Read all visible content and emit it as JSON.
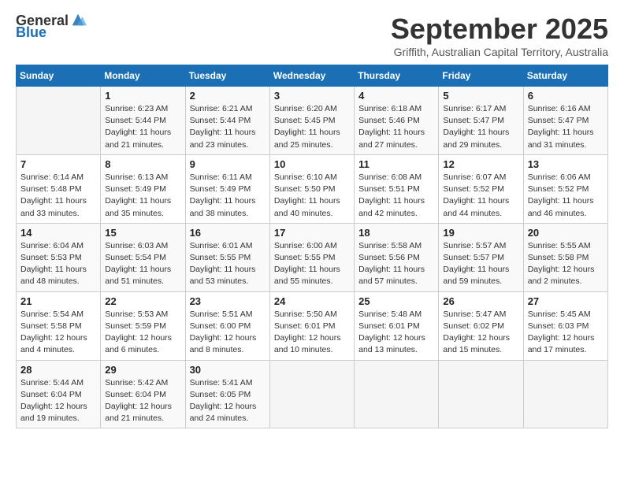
{
  "header": {
    "logo_general": "General",
    "logo_blue": "Blue",
    "title": "September 2025",
    "location": "Griffith, Australian Capital Territory, Australia"
  },
  "calendar": {
    "days_of_week": [
      "Sunday",
      "Monday",
      "Tuesday",
      "Wednesday",
      "Thursday",
      "Friday",
      "Saturday"
    ],
    "weeks": [
      [
        {
          "day": "",
          "info": ""
        },
        {
          "day": "1",
          "info": "Sunrise: 6:23 AM\nSunset: 5:44 PM\nDaylight: 11 hours\nand 21 minutes."
        },
        {
          "day": "2",
          "info": "Sunrise: 6:21 AM\nSunset: 5:44 PM\nDaylight: 11 hours\nand 23 minutes."
        },
        {
          "day": "3",
          "info": "Sunrise: 6:20 AM\nSunset: 5:45 PM\nDaylight: 11 hours\nand 25 minutes."
        },
        {
          "day": "4",
          "info": "Sunrise: 6:18 AM\nSunset: 5:46 PM\nDaylight: 11 hours\nand 27 minutes."
        },
        {
          "day": "5",
          "info": "Sunrise: 6:17 AM\nSunset: 5:47 PM\nDaylight: 11 hours\nand 29 minutes."
        },
        {
          "day": "6",
          "info": "Sunrise: 6:16 AM\nSunset: 5:47 PM\nDaylight: 11 hours\nand 31 minutes."
        }
      ],
      [
        {
          "day": "7",
          "info": "Sunrise: 6:14 AM\nSunset: 5:48 PM\nDaylight: 11 hours\nand 33 minutes."
        },
        {
          "day": "8",
          "info": "Sunrise: 6:13 AM\nSunset: 5:49 PM\nDaylight: 11 hours\nand 35 minutes."
        },
        {
          "day": "9",
          "info": "Sunrise: 6:11 AM\nSunset: 5:49 PM\nDaylight: 11 hours\nand 38 minutes."
        },
        {
          "day": "10",
          "info": "Sunrise: 6:10 AM\nSunset: 5:50 PM\nDaylight: 11 hours\nand 40 minutes."
        },
        {
          "day": "11",
          "info": "Sunrise: 6:08 AM\nSunset: 5:51 PM\nDaylight: 11 hours\nand 42 minutes."
        },
        {
          "day": "12",
          "info": "Sunrise: 6:07 AM\nSunset: 5:52 PM\nDaylight: 11 hours\nand 44 minutes."
        },
        {
          "day": "13",
          "info": "Sunrise: 6:06 AM\nSunset: 5:52 PM\nDaylight: 11 hours\nand 46 minutes."
        }
      ],
      [
        {
          "day": "14",
          "info": "Sunrise: 6:04 AM\nSunset: 5:53 PM\nDaylight: 11 hours\nand 48 minutes."
        },
        {
          "day": "15",
          "info": "Sunrise: 6:03 AM\nSunset: 5:54 PM\nDaylight: 11 hours\nand 51 minutes."
        },
        {
          "day": "16",
          "info": "Sunrise: 6:01 AM\nSunset: 5:55 PM\nDaylight: 11 hours\nand 53 minutes."
        },
        {
          "day": "17",
          "info": "Sunrise: 6:00 AM\nSunset: 5:55 PM\nDaylight: 11 hours\nand 55 minutes."
        },
        {
          "day": "18",
          "info": "Sunrise: 5:58 AM\nSunset: 5:56 PM\nDaylight: 11 hours\nand 57 minutes."
        },
        {
          "day": "19",
          "info": "Sunrise: 5:57 AM\nSunset: 5:57 PM\nDaylight: 11 hours\nand 59 minutes."
        },
        {
          "day": "20",
          "info": "Sunrise: 5:55 AM\nSunset: 5:58 PM\nDaylight: 12 hours\nand 2 minutes."
        }
      ],
      [
        {
          "day": "21",
          "info": "Sunrise: 5:54 AM\nSunset: 5:58 PM\nDaylight: 12 hours\nand 4 minutes."
        },
        {
          "day": "22",
          "info": "Sunrise: 5:53 AM\nSunset: 5:59 PM\nDaylight: 12 hours\nand 6 minutes."
        },
        {
          "day": "23",
          "info": "Sunrise: 5:51 AM\nSunset: 6:00 PM\nDaylight: 12 hours\nand 8 minutes."
        },
        {
          "day": "24",
          "info": "Sunrise: 5:50 AM\nSunset: 6:01 PM\nDaylight: 12 hours\nand 10 minutes."
        },
        {
          "day": "25",
          "info": "Sunrise: 5:48 AM\nSunset: 6:01 PM\nDaylight: 12 hours\nand 13 minutes."
        },
        {
          "day": "26",
          "info": "Sunrise: 5:47 AM\nSunset: 6:02 PM\nDaylight: 12 hours\nand 15 minutes."
        },
        {
          "day": "27",
          "info": "Sunrise: 5:45 AM\nSunset: 6:03 PM\nDaylight: 12 hours\nand 17 minutes."
        }
      ],
      [
        {
          "day": "28",
          "info": "Sunrise: 5:44 AM\nSunset: 6:04 PM\nDaylight: 12 hours\nand 19 minutes."
        },
        {
          "day": "29",
          "info": "Sunrise: 5:42 AM\nSunset: 6:04 PM\nDaylight: 12 hours\nand 21 minutes."
        },
        {
          "day": "30",
          "info": "Sunrise: 5:41 AM\nSunset: 6:05 PM\nDaylight: 12 hours\nand 24 minutes."
        },
        {
          "day": "",
          "info": ""
        },
        {
          "day": "",
          "info": ""
        },
        {
          "day": "",
          "info": ""
        },
        {
          "day": "",
          "info": ""
        }
      ]
    ]
  }
}
